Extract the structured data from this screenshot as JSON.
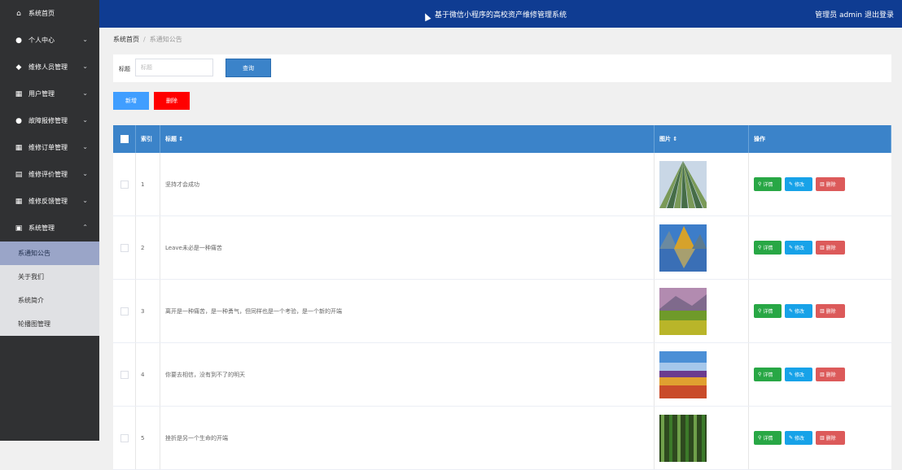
{
  "header": {
    "title": "基于微信小程序的高校资产维修管理系统",
    "user": "管理员 admin  退出登录"
  },
  "sidebar": {
    "items": [
      {
        "label": "系统首页",
        "icon": "home-icon",
        "chev": ""
      },
      {
        "label": "个人中心",
        "icon": "user-icon",
        "chev": "⌄"
      },
      {
        "label": "维修人员管理",
        "icon": "tag-icon",
        "chev": "⌄"
      },
      {
        "label": "用户管理",
        "icon": "grid-icon",
        "chev": "⌄"
      },
      {
        "label": "故障报修管理",
        "icon": "user-icon",
        "chev": "⌄"
      },
      {
        "label": "维修订单管理",
        "icon": "grid-icon",
        "chev": "⌄"
      },
      {
        "label": "维修评价管理",
        "icon": "clipboard-icon",
        "chev": "⌄"
      },
      {
        "label": "维修反馈管理",
        "icon": "grid-icon",
        "chev": "⌄"
      },
      {
        "label": "系统管理",
        "icon": "window-icon",
        "chev": "⌃"
      }
    ],
    "subitems": [
      {
        "label": "系通知公告",
        "active": true
      },
      {
        "label": "关于我们",
        "active": false
      },
      {
        "label": "系统简介",
        "active": false
      },
      {
        "label": "轮播图管理",
        "active": false
      }
    ]
  },
  "breadcrumb": {
    "home": "系统首页",
    "current": "系通知公告"
  },
  "search": {
    "label": "标题",
    "placeholder": "标题",
    "button": "查询"
  },
  "actions": {
    "add": "新增",
    "delete": "删除"
  },
  "table": {
    "headers": {
      "index": "索引",
      "title": "标题 ⇕",
      "pic": "图片 ⇕",
      "op": "操作"
    },
    "row_buttons": {
      "detail": "详情",
      "edit": "修改",
      "delete": "删除"
    },
    "rows": [
      {
        "index": "1",
        "title": "坚持才会成功"
      },
      {
        "index": "2",
        "title": "Leave未必是一种痛苦"
      },
      {
        "index": "3",
        "title": "离开是一种痛苦，是一种勇气，但同样也是一个考验，是一个新的开端"
      },
      {
        "index": "4",
        "title": "你要去相信，没有到不了的明天"
      },
      {
        "index": "5",
        "title": "挫折是另一个生命的开端"
      }
    ]
  },
  "colors": {
    "header": "#0f3c92",
    "sidebar": "#303133",
    "table_head": "#3b83c9",
    "detail": "#28a745",
    "edit": "#17a2e8",
    "delete": "#dc5a5a"
  }
}
